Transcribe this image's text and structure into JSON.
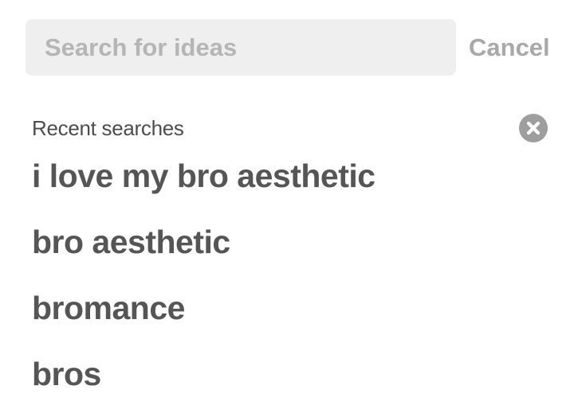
{
  "search": {
    "placeholder": "Search for ideas",
    "value": ""
  },
  "cancel_label": "Cancel",
  "recent": {
    "heading": "Recent searches",
    "clear_icon": "close-circle-icon",
    "items": [
      "i love my bro aesthetic",
      "bro aesthetic",
      "bromance",
      "bros"
    ]
  },
  "colors": {
    "search_bg": "#efefef",
    "placeholder": "#b5b5b5",
    "cancel": "#a9a9a9",
    "heading": "#4d4d4d",
    "item": "#555555",
    "clear_icon_bg": "#9e9e9e"
  }
}
